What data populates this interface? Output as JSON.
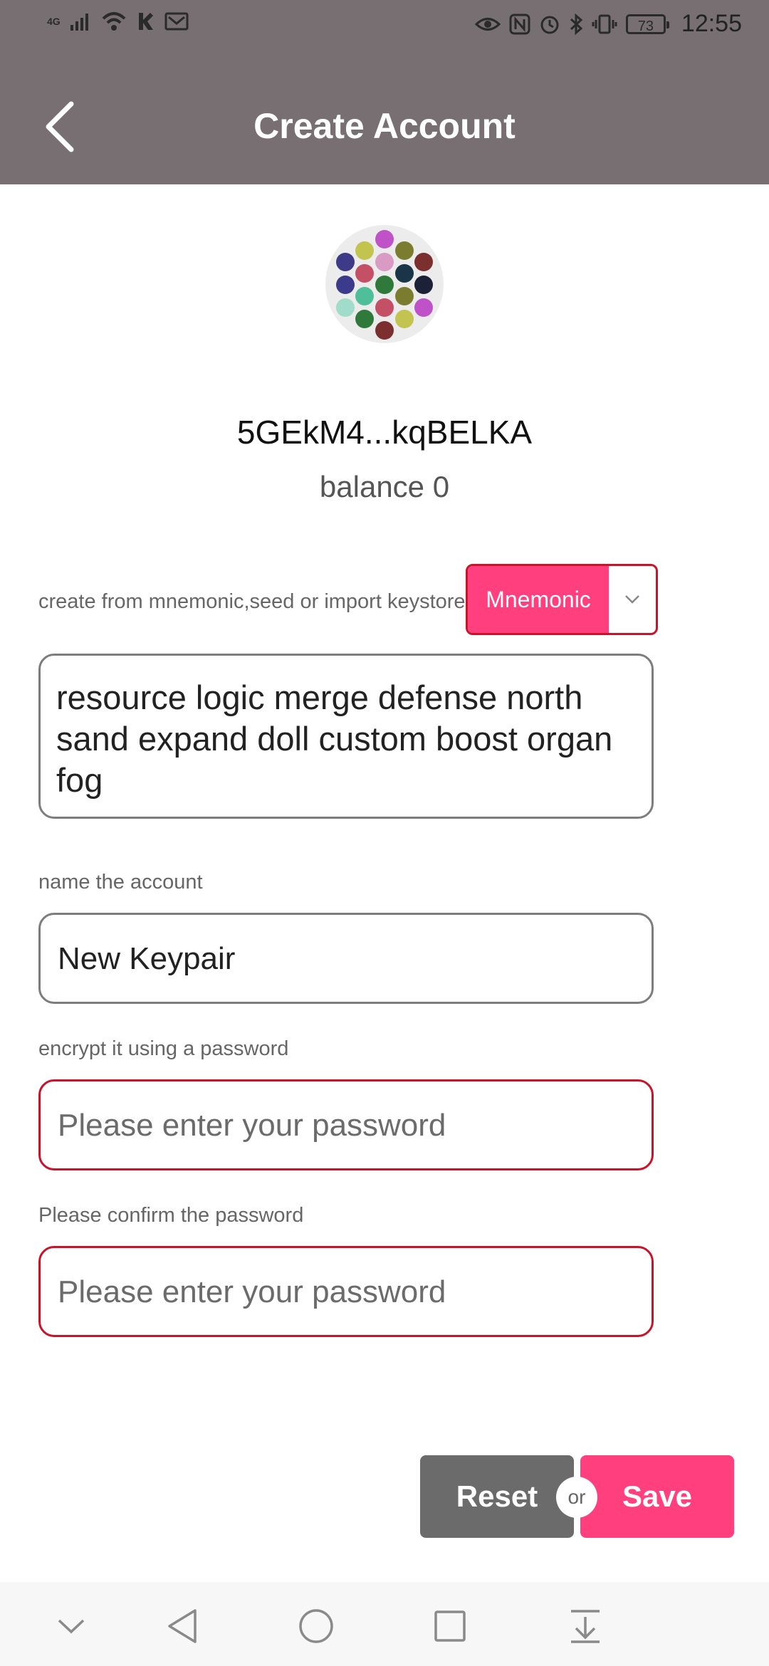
{
  "status_bar": {
    "network": "4G",
    "battery": "73",
    "time": "12:55",
    "icons": [
      "signal-icon",
      "wifi-icon",
      "notification-icon",
      "mail-icon",
      "eye-icon",
      "nfc-icon",
      "alarm-icon",
      "bluetooth-icon",
      "vibrate-icon",
      "battery-icon"
    ]
  },
  "header": {
    "title": "Create Account",
    "back_icon": "back-chevron-icon"
  },
  "account": {
    "address": "5GEkM4...kqBELKA",
    "balance": "balance 0",
    "avatar_colors": [
      "#c052c8",
      "#c3c34f",
      "#7b7c2e",
      "#3f3a87",
      "#d99ac4",
      "#7b2f2f",
      "#c45066",
      "#1a3448",
      "#3c3a8a",
      "#2f7a3a",
      "#1c2138",
      "#4fbf99",
      "#7b7c2e",
      "#a0dcc9",
      "#c45066",
      "#c052c8",
      "#2f7a3a",
      "#c3c34f",
      "#7b2f2f"
    ]
  },
  "form": {
    "source_label": "create from mnemonic,seed or import keystore",
    "source_selected": "Mnemonic",
    "mnemonic": "resource logic merge defense north sand expand doll custom boost organ fog",
    "name_label": "name the account",
    "name_value": "New Keypair",
    "password_label": "encrypt it using a password",
    "password_placeholder": "Please enter your password",
    "confirm_label": "Please confirm the password",
    "confirm_placeholder": "Please enter your password"
  },
  "actions": {
    "reset": "Reset",
    "or": "or",
    "save": "Save",
    "accent_color": "#ff3f7e",
    "neutral_color": "#6b6b6b"
  },
  "navbar": {
    "icons": [
      "collapse-icon",
      "back-icon",
      "home-icon",
      "recents-icon",
      "notification-pull-icon"
    ]
  }
}
